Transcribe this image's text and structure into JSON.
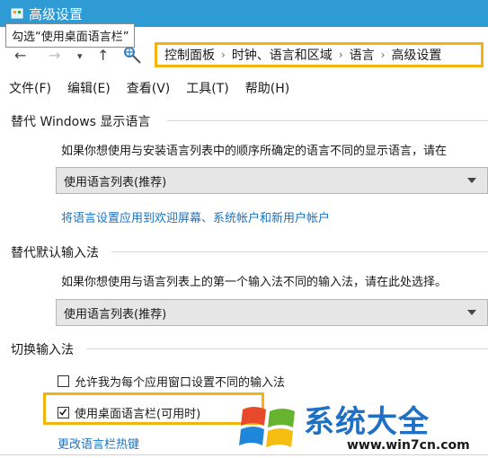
{
  "window": {
    "title": "高级设置",
    "titlebar_color": "#2f9bd5"
  },
  "tooltip": "勾选“使用桌面语言栏”",
  "nav": {
    "back_icon": "arrow-left-icon",
    "forward_icon": "arrow-right-icon",
    "recent_icon": "chevron-down-icon",
    "up_icon": "arrow-up-icon",
    "breadcrumb": [
      "控制面板",
      "时钟、语言和区域",
      "语言",
      "高级设置"
    ],
    "breadcrumb_sep": "›"
  },
  "menu": [
    "文件(F)",
    "编辑(E)",
    "查看(V)",
    "工具(T)",
    "帮助(H)"
  ],
  "display_language": {
    "title": "替代 Windows 显示语言",
    "description": "如果你想使用与安装语言列表中的顺序所确定的语言不同的显示语言，请在",
    "combo_value": "使用语言列表(推荐)",
    "link": "将语言设置应用到欢迎屏幕、系统帐户和新用户帐户"
  },
  "input_method": {
    "title": "替代默认输入法",
    "description": "如果你想使用与语言列表上的第一个输入法不同的输入法，请在此处选择。",
    "combo_value": "使用语言列表(推荐)"
  },
  "switching": {
    "title": "切换输入法",
    "option1": {
      "label": "允许我为每个应用窗口设置不同的输入法",
      "checked": false
    },
    "option2": {
      "label": "使用桌面语言栏(可用时)",
      "checked": true
    },
    "link": "更改语言栏热键"
  },
  "watermark": {
    "text": "系统大全",
    "url": "www.win7cn.com",
    "logo": "windows-flag-logo"
  },
  "colors": {
    "highlight": "#f3b40e",
    "link": "#1e73be"
  }
}
